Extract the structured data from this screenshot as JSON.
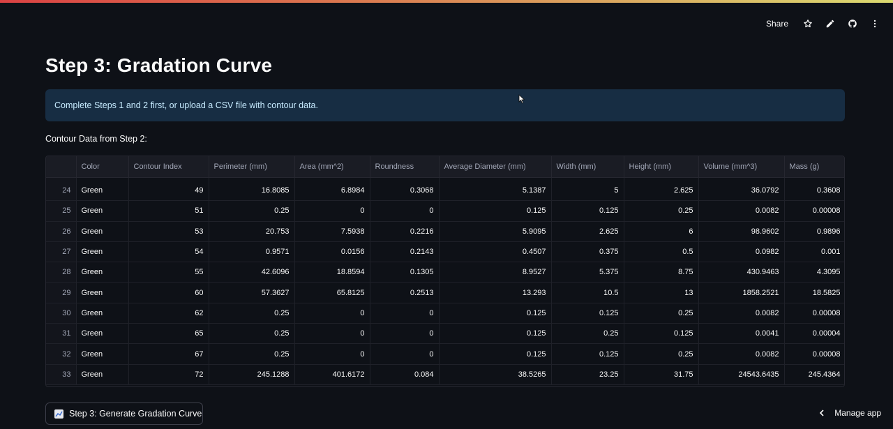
{
  "header": {
    "share_label": "Share"
  },
  "page": {
    "title": "Step 3: Gradation Curve",
    "info_message": "Complete Steps 1 and 2 first, or upload a CSV file with contour data.",
    "section_label": "Contour Data from Step 2:"
  },
  "table": {
    "columns": [
      "",
      "Color",
      "Contour Index",
      "Perimeter (mm)",
      "Area (mm^2)",
      "Roundness",
      "Average Diameter (mm)",
      "Width (mm)",
      "Height (mm)",
      "Volume (mm^3)",
      "Mass (g)"
    ],
    "rows": [
      [
        "24",
        "Green",
        "49",
        "16.8085",
        "6.8984",
        "0.3068",
        "5.1387",
        "5",
        "2.625",
        "36.0792",
        "0.3608"
      ],
      [
        "25",
        "Green",
        "51",
        "0.25",
        "0",
        "0",
        "0.125",
        "0.125",
        "0.25",
        "0.0082",
        "0.00008"
      ],
      [
        "26",
        "Green",
        "53",
        "20.753",
        "7.5938",
        "0.2216",
        "5.9095",
        "2.625",
        "6",
        "98.9602",
        "0.9896"
      ],
      [
        "27",
        "Green",
        "54",
        "0.9571",
        "0.0156",
        "0.2143",
        "0.4507",
        "0.375",
        "0.5",
        "0.0982",
        "0.001"
      ],
      [
        "28",
        "Green",
        "55",
        "42.6096",
        "18.8594",
        "0.1305",
        "8.9527",
        "5.375",
        "8.75",
        "430.9463",
        "4.3095"
      ],
      [
        "29",
        "Green",
        "60",
        "57.3627",
        "65.8125",
        "0.2513",
        "13.293",
        "10.5",
        "13",
        "1858.2521",
        "18.5825"
      ],
      [
        "30",
        "Green",
        "62",
        "0.25",
        "0",
        "0",
        "0.125",
        "0.125",
        "0.25",
        "0.0082",
        "0.00008"
      ],
      [
        "31",
        "Green",
        "65",
        "0.25",
        "0",
        "0",
        "0.125",
        "0.25",
        "0.125",
        "0.0041",
        "0.00004"
      ],
      [
        "32",
        "Green",
        "67",
        "0.25",
        "0",
        "0",
        "0.125",
        "0.125",
        "0.25",
        "0.0082",
        "0.00008"
      ],
      [
        "33",
        "Green",
        "72",
        "245.1288",
        "401.6172",
        "0.084",
        "38.5265",
        "23.25",
        "31.75",
        "24543.6435",
        "245.4364"
      ]
    ]
  },
  "actions": {
    "generate_label": "Step 3: Generate Gradation Curve",
    "manage_app_label": "Manage app"
  },
  "icons": {
    "star": "star-icon",
    "edit": "pencil-icon",
    "github": "github-icon",
    "menu": "kebab-menu-icon",
    "chart": "chart-icon",
    "chevron": "chevron-left-icon"
  },
  "colors": {
    "background": "#0e1117",
    "info_bg": "#172d43",
    "info_text": "#c7ebff",
    "accent": "#ff4b4b"
  }
}
